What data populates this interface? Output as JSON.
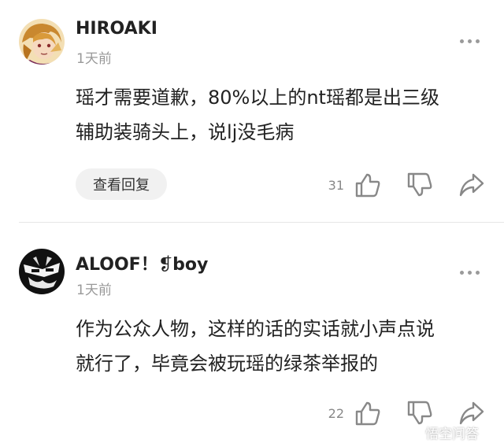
{
  "comments": [
    {
      "username": "HIROAKI",
      "time": "1天前",
      "content_lines": [
        "瑶才需要道歉，80%以上的nt瑶都是出三级",
        "辅助装骑头上，说lj没毛病"
      ],
      "reply_label": "查看回复",
      "likes": "31",
      "avatar_icon": "anime-character-avatar",
      "more_icon": "more-dots-icon",
      "like_icon": "thumbs-up-icon",
      "dislike_icon": "thumbs-down-icon",
      "share_icon": "share-arrow-icon"
    },
    {
      "username": "ALOOF！❡boy",
      "time": "1天前",
      "content_lines": [
        "作为公众人物，这样的话的实话就小声点说",
        "就行了，毕竟会被玩瑶的绿茶举报的"
      ],
      "likes": "22",
      "avatar_icon": "black-white-graphic-avatar",
      "more_icon": "more-dots-icon",
      "like_icon": "thumbs-up-icon",
      "dislike_icon": "thumbs-down-icon",
      "share_icon": "share-arrow-icon"
    }
  ],
  "watermark": {
    "text": "悟空问答",
    "icon": "wukong-logo-icon"
  },
  "colors": {
    "text": "#222222",
    "muted": "#999999",
    "icon": "#888888",
    "button_bg": "#f1f1f1",
    "divider": "#e6e6e6"
  }
}
